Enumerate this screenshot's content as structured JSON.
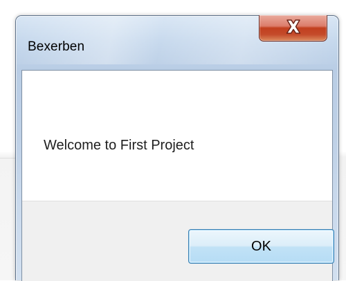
{
  "dialog": {
    "title": "Bexerben",
    "message": "Welcome to First Project",
    "buttons": {
      "ok_label": "OK"
    },
    "title_bar": {
      "close_icon": "close-icon"
    }
  },
  "colors": {
    "close_button": "#c74a2c",
    "ok_button_border": "#3c7fb1",
    "button_area_bg": "#f0f0f0"
  }
}
